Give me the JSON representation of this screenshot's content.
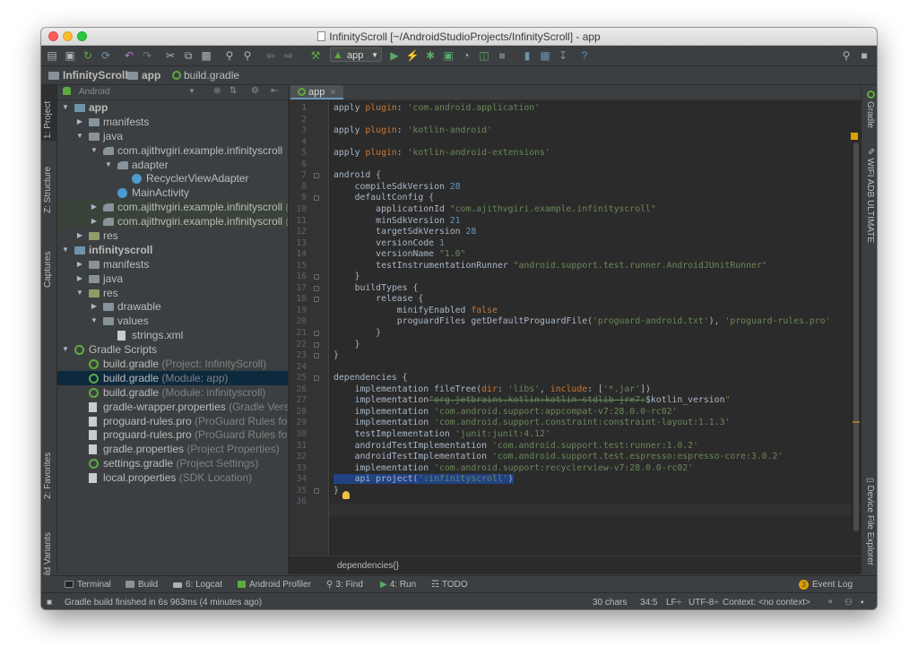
{
  "window": {
    "title": "InfinityScroll [~/AndroidStudioProjects/InfinityScroll] - app"
  },
  "toolbar": {
    "run_config": "app"
  },
  "breadcrumbs": [
    {
      "label": "InfinityScroll",
      "icon": "folder-icon"
    },
    {
      "label": "app",
      "icon": "folder-icon"
    },
    {
      "label": "build.gradle",
      "icon": "gradle-icon"
    }
  ],
  "left_tool_tabs": [
    {
      "label": "1: Project"
    },
    {
      "label": "Z: Structure"
    },
    {
      "label": "Captures"
    },
    {
      "label": "2: Favorites"
    },
    {
      "label": "Build Variants"
    }
  ],
  "right_tool_tabs": [
    {
      "label": "Gradle"
    },
    {
      "label": "WIFI ADB ULTIMATE"
    },
    {
      "label": "Device File Explorer"
    }
  ],
  "project_panel": {
    "view_selector": "Android",
    "tree": [
      {
        "name": "app",
        "level": 0,
        "icon": "module",
        "arrow": "down",
        "bold": true
      },
      {
        "name": "manifests",
        "level": 1,
        "icon": "folder",
        "arrow": "right"
      },
      {
        "name": "java",
        "level": 1,
        "icon": "folder",
        "arrow": "down"
      },
      {
        "name": "com.ajithvgiri.example.infinityscroll",
        "level": 2,
        "icon": "pkg",
        "arrow": "down"
      },
      {
        "name": "adapter",
        "level": 3,
        "icon": "pkg",
        "arrow": "down"
      },
      {
        "name": "RecyclerViewAdapter",
        "level": 4,
        "icon": "kt",
        "arrow": ""
      },
      {
        "name": "MainActivity",
        "level": 3,
        "icon": "kt",
        "arrow": ""
      },
      {
        "name": "com.ajithvgiri.example.infinityscroll",
        "suffix": " (a",
        "level": 2,
        "icon": "pkg",
        "arrow": "right",
        "highlight": true
      },
      {
        "name": "com.ajithvgiri.example.infinityscroll",
        "suffix": " (t",
        "level": 2,
        "icon": "pkg",
        "arrow": "right",
        "highlight": true
      },
      {
        "name": "res",
        "level": 1,
        "icon": "res",
        "arrow": "right"
      },
      {
        "name": "infinityscroll",
        "level": 0,
        "icon": "module",
        "arrow": "down",
        "bold": true
      },
      {
        "name": "manifests",
        "level": 1,
        "icon": "folder",
        "arrow": "right"
      },
      {
        "name": "java",
        "level": 1,
        "icon": "folder",
        "arrow": "right"
      },
      {
        "name": "res",
        "level": 1,
        "icon": "res",
        "arrow": "down"
      },
      {
        "name": "drawable",
        "level": 2,
        "icon": "folder",
        "arrow": "right"
      },
      {
        "name": "values",
        "level": 2,
        "icon": "folder",
        "arrow": "down"
      },
      {
        "name": "strings.xml",
        "level": 3,
        "icon": "file",
        "arrow": ""
      },
      {
        "name": "Gradle Scripts",
        "level": 0,
        "icon": "gr",
        "arrow": "down"
      },
      {
        "name": "build.gradle",
        "suffix": " (Project: InfinityScroll)",
        "level": 1,
        "icon": "gr",
        "arrow": ""
      },
      {
        "name": "build.gradle",
        "suffix": " (Module: app)",
        "level": 1,
        "icon": "gr",
        "arrow": "",
        "selected": true
      },
      {
        "name": "build.gradle",
        "suffix": " (Module: infinityscroll)",
        "level": 1,
        "icon": "gr",
        "arrow": ""
      },
      {
        "name": "gradle-wrapper.properties",
        "suffix": " (Gradle Versio",
        "level": 1,
        "icon": "file",
        "arrow": ""
      },
      {
        "name": "proguard-rules.pro",
        "suffix": " (ProGuard Rules for",
        "level": 1,
        "icon": "file",
        "arrow": ""
      },
      {
        "name": "proguard-rules.pro",
        "suffix": " (ProGuard Rules for",
        "level": 1,
        "icon": "file",
        "arrow": ""
      },
      {
        "name": "gradle.properties",
        "suffix": " (Project Properties)",
        "level": 1,
        "icon": "file",
        "arrow": ""
      },
      {
        "name": "settings.gradle",
        "suffix": " (Project Settings)",
        "level": 1,
        "icon": "gr",
        "arrow": ""
      },
      {
        "name": "local.properties",
        "suffix": " (SDK Location)",
        "level": 1,
        "icon": "file",
        "arrow": ""
      }
    ]
  },
  "editor": {
    "tab_label": "app",
    "breadcrumb": "dependencies{}",
    "lines": [
      [
        [
          "",
          "apply "
        ],
        [
          "kw",
          "plugin"
        ],
        [
          "",
          ": "
        ],
        [
          "str",
          "'com.android.application'"
        ]
      ],
      [],
      [
        [
          "",
          "apply "
        ],
        [
          "kw",
          "plugin"
        ],
        [
          "",
          ": "
        ],
        [
          "str",
          "'kotlin-android'"
        ]
      ],
      [],
      [
        [
          "",
          "apply "
        ],
        [
          "kw",
          "plugin"
        ],
        [
          "",
          ": "
        ],
        [
          "str",
          "'kotlin-android-extensions'"
        ]
      ],
      [],
      [
        [
          "",
          "android {"
        ]
      ],
      [
        [
          "",
          "    compileSdkVersion "
        ],
        [
          "num",
          "28"
        ]
      ],
      [
        [
          "",
          "    defaultConfig {"
        ]
      ],
      [
        [
          "",
          "        applicationId "
        ],
        [
          "str",
          "\"com.ajithvgiri.example.infinityscroll\""
        ]
      ],
      [
        [
          "",
          "        minSdkVersion "
        ],
        [
          "num",
          "21"
        ]
      ],
      [
        [
          "",
          "        targetSdkVersion "
        ],
        [
          "num",
          "28"
        ]
      ],
      [
        [
          "",
          "        versionCode "
        ],
        [
          "num",
          "1"
        ]
      ],
      [
        [
          "",
          "        versionName "
        ],
        [
          "str",
          "\"1.0\""
        ]
      ],
      [
        [
          "",
          "        testInstrumentationRunner "
        ],
        [
          "str",
          "\"android.support.test.runner.AndroidJUnitRunner\""
        ]
      ],
      [
        [
          "",
          "    }"
        ]
      ],
      [
        [
          "",
          "    buildTypes {"
        ]
      ],
      [
        [
          "",
          "        release {"
        ]
      ],
      [
        [
          "",
          "            minifyEnabled "
        ],
        [
          "kw",
          "false"
        ]
      ],
      [
        [
          "",
          "            proguardFiles getDefaultProguardFile("
        ],
        [
          "str",
          "'proguard-android.txt'"
        ],
        [
          "",
          "), "
        ],
        [
          "str",
          "'proguard-rules.pro'"
        ]
      ],
      [
        [
          "",
          "        }"
        ]
      ],
      [
        [
          "",
          "    }"
        ]
      ],
      [
        [
          "",
          "}"
        ]
      ],
      [],
      [
        [
          "",
          "dependencies {"
        ]
      ],
      [
        [
          "",
          "    implementation fileTree("
        ],
        [
          "kw",
          "dir"
        ],
        [
          "",
          ": "
        ],
        [
          "str",
          "'libs'"
        ],
        [
          "",
          ", "
        ],
        [
          "kw",
          "include"
        ],
        [
          "",
          ": ["
        ],
        [
          "str",
          "'*.jar'"
        ],
        [
          "",
          "])"
        ]
      ],
      [
        [
          "",
          "    implementation"
        ],
        [
          "strike",
          "\"org.jetbrains.kotlin:kotlin-stdlib-jre7:"
        ],
        [
          "",
          "$kotlin_version"
        ],
        [
          "str",
          "\""
        ]
      ],
      [
        [
          "",
          "    implementation "
        ],
        [
          "str",
          "'com.android.support:appcompat-v7:28.0.0-rc02'"
        ]
      ],
      [
        [
          "",
          "    implementation "
        ],
        [
          "str",
          "'com.android.support.constraint:constraint-layout:1.1.3'"
        ]
      ],
      [
        [
          "",
          "    testImplementation "
        ],
        [
          "str",
          "'junit:junit:4.12'"
        ]
      ],
      [
        [
          "",
          "    androidTestImplementation "
        ],
        [
          "str",
          "'com.android.support.test:runner:1.0.2'"
        ]
      ],
      [
        [
          "",
          "    androidTestImplementation "
        ],
        [
          "str",
          "'com.android.support.test.espresso:espresso-core:3.0.2'"
        ]
      ],
      [
        [
          "",
          "    implementation "
        ],
        [
          "str",
          "'com.android.support:recyclerview-v7:28.0.0-rc02'"
        ]
      ],
      [
        [
          "sel",
          "    api project("
        ],
        [
          "selstr",
          "':infinityscroll'"
        ],
        [
          "sel",
          ")"
        ]
      ],
      [
        [
          "",
          "}"
        ]
      ],
      []
    ]
  },
  "bottom_tabs": [
    {
      "label": "Terminal",
      "icon": "terminal-icon"
    },
    {
      "label": "Build",
      "icon": "build-icon"
    },
    {
      "label": "6: Logcat",
      "icon": "logcat-icon"
    },
    {
      "label": "Android Profiler",
      "icon": "profiler-icon"
    },
    {
      "label": "3: Find",
      "icon": "find-icon"
    },
    {
      "label": "4: Run",
      "icon": "run-icon"
    },
    {
      "label": "TODO",
      "icon": "todo-icon"
    }
  ],
  "event_log": {
    "label": "Event Log",
    "count": "3"
  },
  "status": {
    "message": "Gradle build finished in 6s 963ms (4 minutes ago)",
    "chars": "30 chars",
    "position": "34:5",
    "line_sep": "LF÷",
    "encoding": "UTF-8÷",
    "context": "Context: <no context>"
  },
  "colors": {
    "background": "#3c3f41",
    "editor": "#2b2b2b",
    "selection": "#0d293e",
    "string": "#6a8759",
    "number": "#6897bb",
    "keyword": "#cc7832",
    "text": "#a9b7c6"
  }
}
